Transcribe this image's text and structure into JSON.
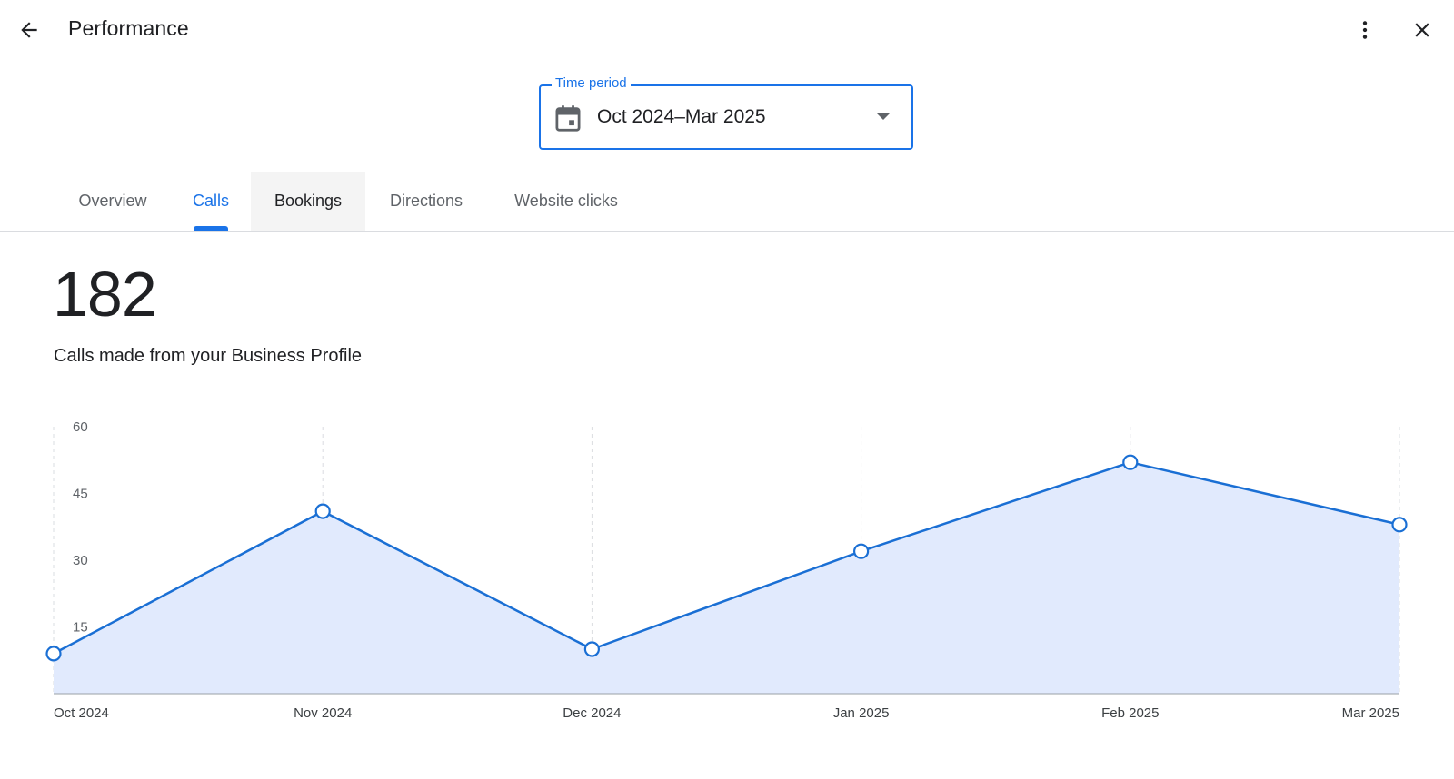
{
  "header": {
    "title": "Performance",
    "back_icon": "arrow-back-icon",
    "more_icon": "more-vert-icon",
    "close_icon": "close-icon"
  },
  "time_period": {
    "legend": "Time period",
    "value": "Oct 2024–Mar 2025",
    "icon": "calendar-icon"
  },
  "tabs": [
    {
      "label": "Overview",
      "active": false
    },
    {
      "label": "Calls",
      "active": true
    },
    {
      "label": "Bookings",
      "active": false,
      "hovered": true
    },
    {
      "label": "Directions",
      "active": false
    },
    {
      "label": "Website clicks",
      "active": false
    }
  ],
  "metric": {
    "value": "182",
    "label": "Calls made from your Business Profile"
  },
  "colors": {
    "accent": "#1a73e8",
    "line": "#1a6fd4",
    "area": "#e1eafd",
    "text": "#202124",
    "muted": "#5f6368"
  },
  "chart_data": {
    "type": "area",
    "categories": [
      "Oct 2024",
      "Nov 2024",
      "Dec 2024",
      "Jan 2025",
      "Feb 2025",
      "Mar 2025"
    ],
    "values": [
      9,
      41,
      10,
      32,
      52,
      38
    ],
    "yticks": [
      15,
      30,
      45,
      60
    ],
    "ylim": [
      0,
      60
    ],
    "grid": "vertical-dashed",
    "markers": "hollow-circle"
  }
}
